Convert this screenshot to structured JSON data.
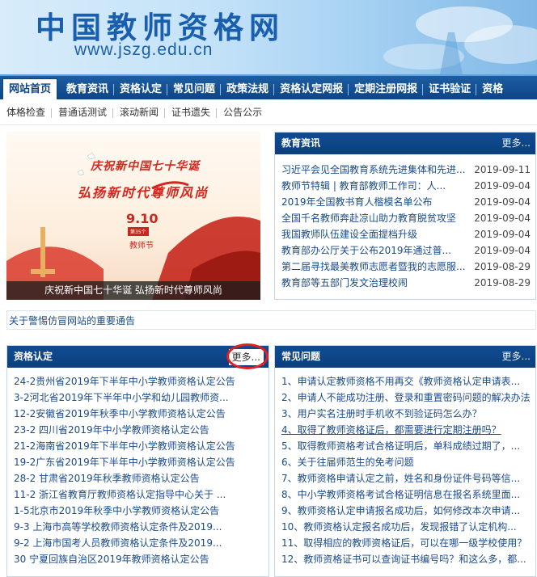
{
  "header": {
    "site_title": "中国教师资格网",
    "site_url": "www.jszg.edu.cn"
  },
  "nav": {
    "items": [
      {
        "label": "网站首页",
        "active": true
      },
      {
        "label": "教育资讯"
      },
      {
        "label": "资格认定"
      },
      {
        "label": "常见问题"
      },
      {
        "label": "政策法规"
      },
      {
        "label": "资格认定网报"
      },
      {
        "label": "定期注册网报"
      },
      {
        "label": "证书验证"
      },
      {
        "label": "资格"
      }
    ]
  },
  "subnav": {
    "items": [
      "体格检查",
      "普通话测试",
      "滚动新闻",
      "证书遗失",
      "公告公示"
    ]
  },
  "slide": {
    "headline1": "庆祝新中国七十华诞",
    "headline2": "弘扬新时代尊师风尚",
    "date": "9.10",
    "badge": "第35个",
    "festival": "教师节",
    "caption": "庆祝新中国七十华诞 弘扬新时代尊师风尚"
  },
  "education_news": {
    "title": "教育资讯",
    "more": "更多...",
    "items": [
      {
        "title": "习近平会见全国教育系统先进集体和先进...",
        "date": "2019-09-11"
      },
      {
        "title": "教师节特辑 | 教育部教师工作司：人...",
        "date": "2019-09-04"
      },
      {
        "title": "2019年全国教书育人楷模名单公布",
        "date": "2019-09-04"
      },
      {
        "title": "全国千名教师奔赴凉山助力教育脱贫攻坚",
        "date": "2019-09-04"
      },
      {
        "title": "我国教师队伍建设全面提档升级",
        "date": "2019-09-04"
      },
      {
        "title": "教育部办公厅关于公布2019年通过普...",
        "date": "2019-09-04"
      },
      {
        "title": "第二届寻找最美教师志愿者暨我的志愿服...",
        "date": "2019-08-29"
      },
      {
        "title": "教育部等五部门发文治理校闹",
        "date": "2019-08-29"
      }
    ]
  },
  "notice": {
    "text": "关于警惕仿冒网站的重要通告"
  },
  "certification": {
    "title": "资格认定",
    "more": "更多...",
    "items": [
      "24-2贵州省2019年下半年中小学教师资格认定公告",
      "3-2河北省2019年下半年中小学和幼儿园教师资...",
      "12-2安徽省2019年秋季中小学教师资格认定公告",
      "23-2 四川省2019年中小学教师资格认定公告",
      "21-2海南省2019年下半年中小学教师资格认定公告",
      "19-2广东省2019年下半年中小学教师资格认定公告",
      "28-2 甘肃省2019年秋季教师资格认定公告",
      "11-2 浙江省教育厅教师资格认定指导中心关于 ...",
      "1-5北京市2019年秋季中小学教师资格认定公告",
      "9-3 上海市高等学校教师资格认定条件及2019...",
      "9-2 上海市国考人员教师资格认定条件及2019...",
      "30 宁夏回族自治区2019年教师资格认定公告"
    ]
  },
  "faq": {
    "title": "常见问题",
    "more": "更多...",
    "items": [
      "1、申请认定教师资格不用再交《教师资格认定申请表...",
      "2、申请人不能成功注册、登录和重置密码问题的解决办法",
      "3、用户实名注册时手机收不到验证码怎么办？",
      "4、取得了教师资格证后，都需要进行定期注册吗？",
      "5、取得教师资格考试合格证明后，单科成绩过期了，...",
      "6、关于往届师范生的免考问题",
      "7、教师资格申请认定之前，姓名和身份证件号码等信...",
      "8、中小学教师资格考试合格证明信息在报名系统里面...",
      "9、教师资格认定申请报名成功后，如何修改本次申请...",
      "10、教师资格认定报名成功后，发现报错了认定机构...",
      "11、取得相应的教师资格证后，可以在哪一级学校使用？",
      "12、教师资格证书可以查询证书编号吗？和这么多，都..."
    ]
  }
}
